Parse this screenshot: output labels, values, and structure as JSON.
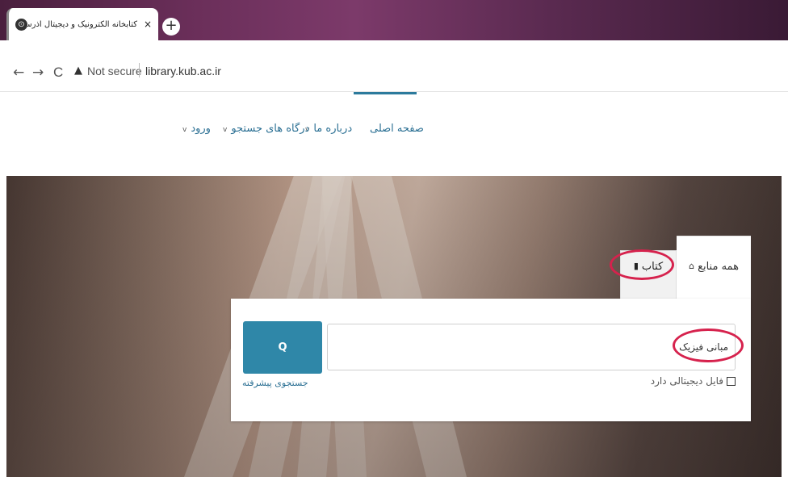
{
  "browser": {
    "tab_title": "کتابخانه الکترونیک و دیجیتال آذرسا - یک سا",
    "tab_close": "×",
    "new_tab": "+",
    "back": "←",
    "forward": "→",
    "reload": "C",
    "security_icon": "▲",
    "security_label": "Not secure",
    "url": "library.kub.ac.ir"
  },
  "nav": {
    "home": "صفحه اصلی",
    "about": "درباره ما",
    "portals": "درگاه های جستجو",
    "login": "ورود",
    "caret": "v"
  },
  "search": {
    "tabs": {
      "all": "همه منابع",
      "all_icon": "بیشتر",
      "book": "کتاب",
      "book_icon": "▮"
    },
    "query": "مبانی فیزیک",
    "button_icon": "Q",
    "digital_label": "فایل دیجیتالی دارد",
    "advanced": "جستجوی پیشرفته"
  },
  "colors": {
    "accent": "#2f87a8",
    "link": "#2a6f93",
    "annotation": "#d6224d"
  }
}
